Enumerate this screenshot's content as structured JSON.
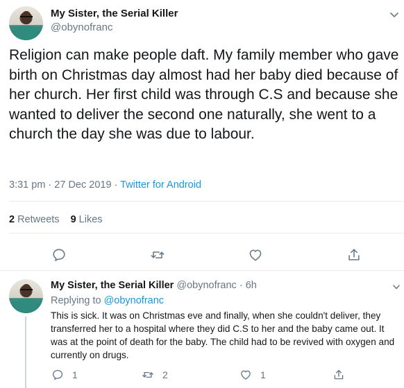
{
  "main_tweet": {
    "display_name": "My Sister, the Serial Killer",
    "handle": "@obynofranc",
    "text": "Religion can make people daft. My family member who gave birth on Christmas day almost had her baby died because of her church. Her first child was through C.S and because she wanted to deliver the second one naturally, she went to a church the day she was due to labour.",
    "time": "3:31 pm",
    "date": "27 Dec 2019",
    "separator": " · ",
    "source": "Twitter for Android",
    "retweets_count": "2",
    "retweets_label": "Retweets",
    "likes_count": "9",
    "likes_label": "Likes"
  },
  "reply_tweet": {
    "display_name": "My Sister, the Serial Killer",
    "handle_age": "@obynofranc · 6h",
    "replying_label": "Replying to",
    "replying_to": "@obynofranc",
    "text": "This is sick. It was on Christmas eve and finally, when she couldn't deliver, they transferred her to a hospital where they did C.S to her and the baby came out. It was at the point of death for the baby. The child had to be revived with oxygen and currently on drugs.",
    "reply_count": "1",
    "retweet_count": "2",
    "like_count": "1"
  },
  "icons": {
    "reply": "reply-icon",
    "retweet": "retweet-icon",
    "like": "heart-icon",
    "share": "share-icon",
    "caret": "chevron-down-icon"
  },
  "colors": {
    "text": "#14171a",
    "secondary": "#657786",
    "link": "#1b95e0",
    "divider": "#e6ecf0"
  }
}
